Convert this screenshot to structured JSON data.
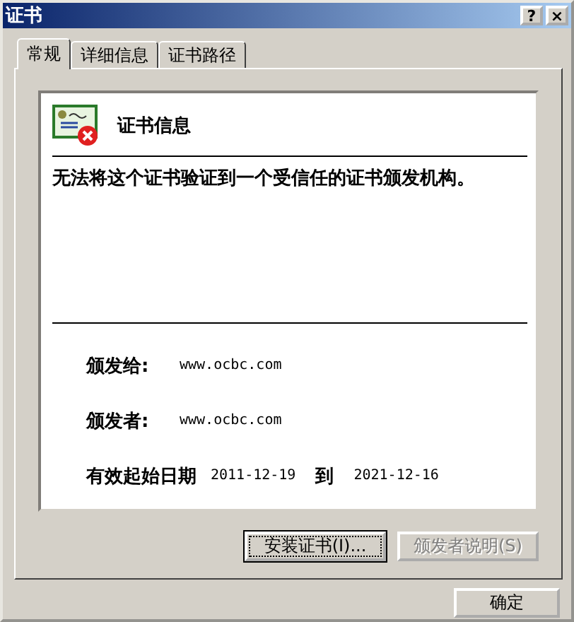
{
  "window": {
    "title": "证书",
    "controls": [
      "?",
      "×"
    ]
  },
  "tabs": [
    {
      "label": "常规",
      "selected": true
    },
    {
      "label": "详细信息",
      "selected": false
    },
    {
      "label": "证书路径",
      "selected": false
    }
  ],
  "header": {
    "title": "证书信息"
  },
  "message": "无法将这个证书验证到一个受信任的证书颁发机构。",
  "fields": [
    {
      "label": "颁发给:",
      "value": "www.ocbc.com"
    },
    {
      "label": "颁发者:",
      "value": "www.ocbc.com"
    }
  ],
  "validity": {
    "label": "有效起始日期",
    "from": "2011-12-19",
    "to_label": "到",
    "to": "2021-12-16"
  },
  "actions": [
    {
      "label": "安装证书(I)...",
      "disabled": false,
      "focused": true
    },
    {
      "label": "颁发者说明(S)",
      "disabled": true,
      "focused": false
    }
  ],
  "footer_buttons": [
    "确定"
  ]
}
